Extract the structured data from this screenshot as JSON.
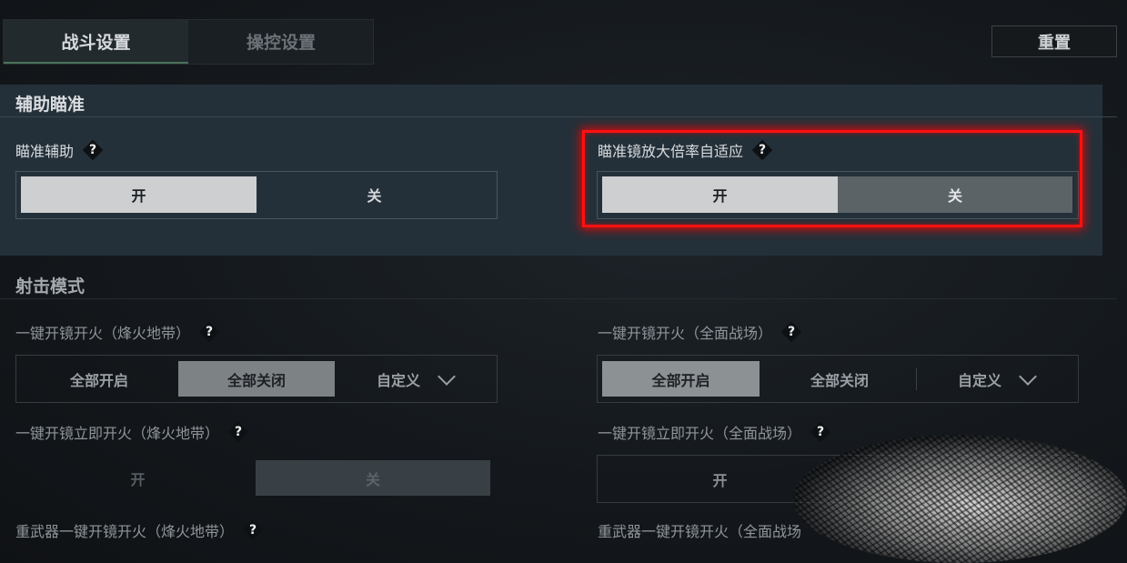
{
  "tabs": [
    {
      "label": "战斗设置",
      "active": true
    },
    {
      "label": "操控设置",
      "active": false
    }
  ],
  "reset_label": "重置",
  "assist": {
    "title": "辅助瞄准",
    "aim_assist": {
      "label": "瞄准辅助",
      "help": "?",
      "on": "开",
      "off": "关",
      "value": "开"
    },
    "scope_adaptive": {
      "label": "瞄准镜放大倍率自适应",
      "help": "?",
      "on": "开",
      "off": "关",
      "value": "开"
    }
  },
  "shooting": {
    "title": "射击模式",
    "scope_fire_beacon": {
      "label": "一键开镜开火（烽火地带）",
      "help": "?",
      "options": [
        "全部开启",
        "全部关闭",
        "自定义"
      ],
      "selected": "全部关闭"
    },
    "scope_fire_battlefield": {
      "label": "一键开镜开火（全面战场）",
      "help": "?",
      "options": [
        "全部开启",
        "全部关闭",
        "自定义"
      ],
      "selected": "全部开启"
    },
    "instant_fire_beacon": {
      "label": "一键开镜立即开火（烽火地带）",
      "help": "?",
      "on": "开",
      "off": "关",
      "value": "关"
    },
    "instant_fire_battlefield": {
      "label": "一键开镜立即开火（全面战场）",
      "help": "?",
      "on": "开"
    },
    "heavy_beacon": {
      "label": "重武器一键开镜开火（烽火地带）",
      "help": "?"
    },
    "heavy_battlefield": {
      "label": "重武器一键开镜开火（全面战场"
    }
  },
  "colors": {
    "highlight": "#ff1111",
    "accent_underline": "#49725c"
  }
}
